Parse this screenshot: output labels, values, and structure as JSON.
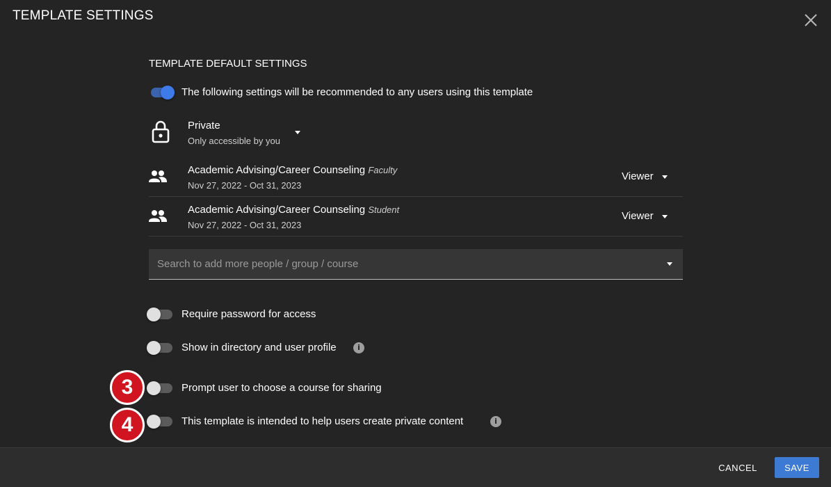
{
  "dialog": {
    "title": "TEMPLATE SETTINGS",
    "close_icon": "close-icon"
  },
  "section": {
    "title": "TEMPLATE DEFAULT SETTINGS",
    "recommend_toggle": {
      "on": true,
      "label": "The following settings will be recommended to any users using this template"
    }
  },
  "privacy": {
    "icon": "lock-icon",
    "value": "Private",
    "description": "Only accessible by you"
  },
  "sharing": [
    {
      "icon": "people-icon",
      "name": "Academic Advising/Career Counseling",
      "role_tag": "Faculty",
      "dates": "Nov 27, 2022 - Oct 31, 2023",
      "permission": "Viewer"
    },
    {
      "icon": "people-icon",
      "name": "Academic Advising/Career Counseling",
      "role_tag": "Student",
      "dates": "Nov 27, 2022 - Oct 31, 2023",
      "permission": "Viewer"
    }
  ],
  "search": {
    "placeholder": "Search to add more people / group / course",
    "value": ""
  },
  "options": [
    {
      "label": "Require password for access",
      "on": false,
      "info": false
    },
    {
      "label": "Show in directory and user profile",
      "on": false,
      "info": true
    },
    {
      "label": "Prompt user to choose a course for sharing",
      "on": false,
      "info": false,
      "badge": "3"
    },
    {
      "label": "This template is intended to help users create private content",
      "on": false,
      "info": true,
      "badge": "4"
    }
  ],
  "info_glyph": "i",
  "footer": {
    "cancel_label": "CANCEL",
    "save_label": "SAVE"
  },
  "colors": {
    "background": "#242424",
    "accent": "#3c7ad4",
    "badge": "#d01520"
  }
}
